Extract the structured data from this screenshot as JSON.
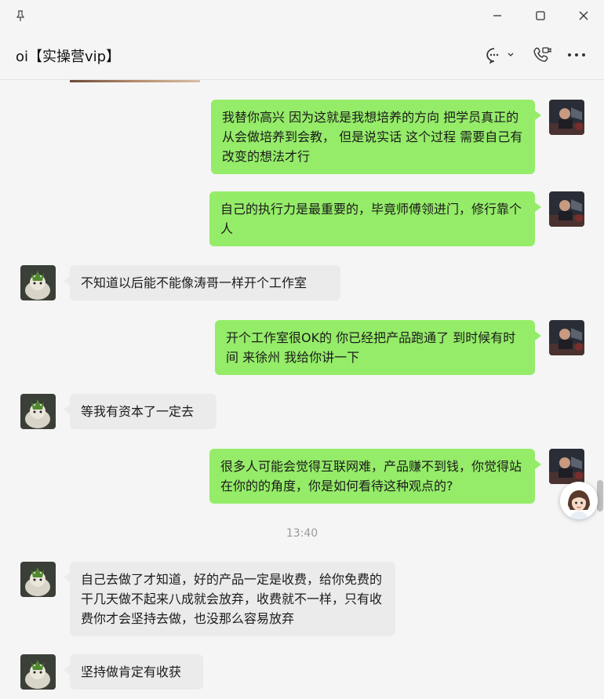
{
  "window": {
    "pin_icon": "pin-icon",
    "minimize_icon": "minimize-icon",
    "maximize_icon": "maximize-icon",
    "close_icon": "close-icon"
  },
  "header": {
    "title": "oi【实操营vip】",
    "chat_icon": "chat-bubble-icon",
    "call_icon": "phone-video-icon",
    "more_icon": "more-icon"
  },
  "messages": [
    {
      "side": "out",
      "text": "我替你高兴 因为这就是我想培养的方向  把学员真正的从会做培养到会教，  但是说实话 这个过程 需要自己有改变的想法才行"
    },
    {
      "side": "out",
      "text": "自己的执行力是最重要的，毕竟师傅领进门，修行靠个人"
    },
    {
      "side": "in",
      "text": "不知道以后能不能像涛哥一样开个工作室"
    },
    {
      "side": "out",
      "text": "开个工作室很OK的   你已经把产品跑通了 到时候有时间 来徐州 我给你讲一下"
    },
    {
      "side": "in",
      "text": "等我有资本了一定去"
    },
    {
      "side": "out",
      "text": "很多人可能会觉得互联网难，产品赚不到钱，你觉得站在你的的角度，你是如何看待这种观点的?"
    },
    {
      "side": "in",
      "text": "自己去做了才知道，好的产品一定是收费，给你免费的干几天做不起来八成就会放弃，收费就不一样，只有收费你才会坚持去做，也没那么容易放弃"
    },
    {
      "side": "in",
      "text": "坚持做肯定有收获"
    }
  ],
  "timestamp": "13:40",
  "colors": {
    "out_bubble": "#95ec69",
    "in_bubble": "#ebebeb",
    "background": "#f5f5f5"
  }
}
